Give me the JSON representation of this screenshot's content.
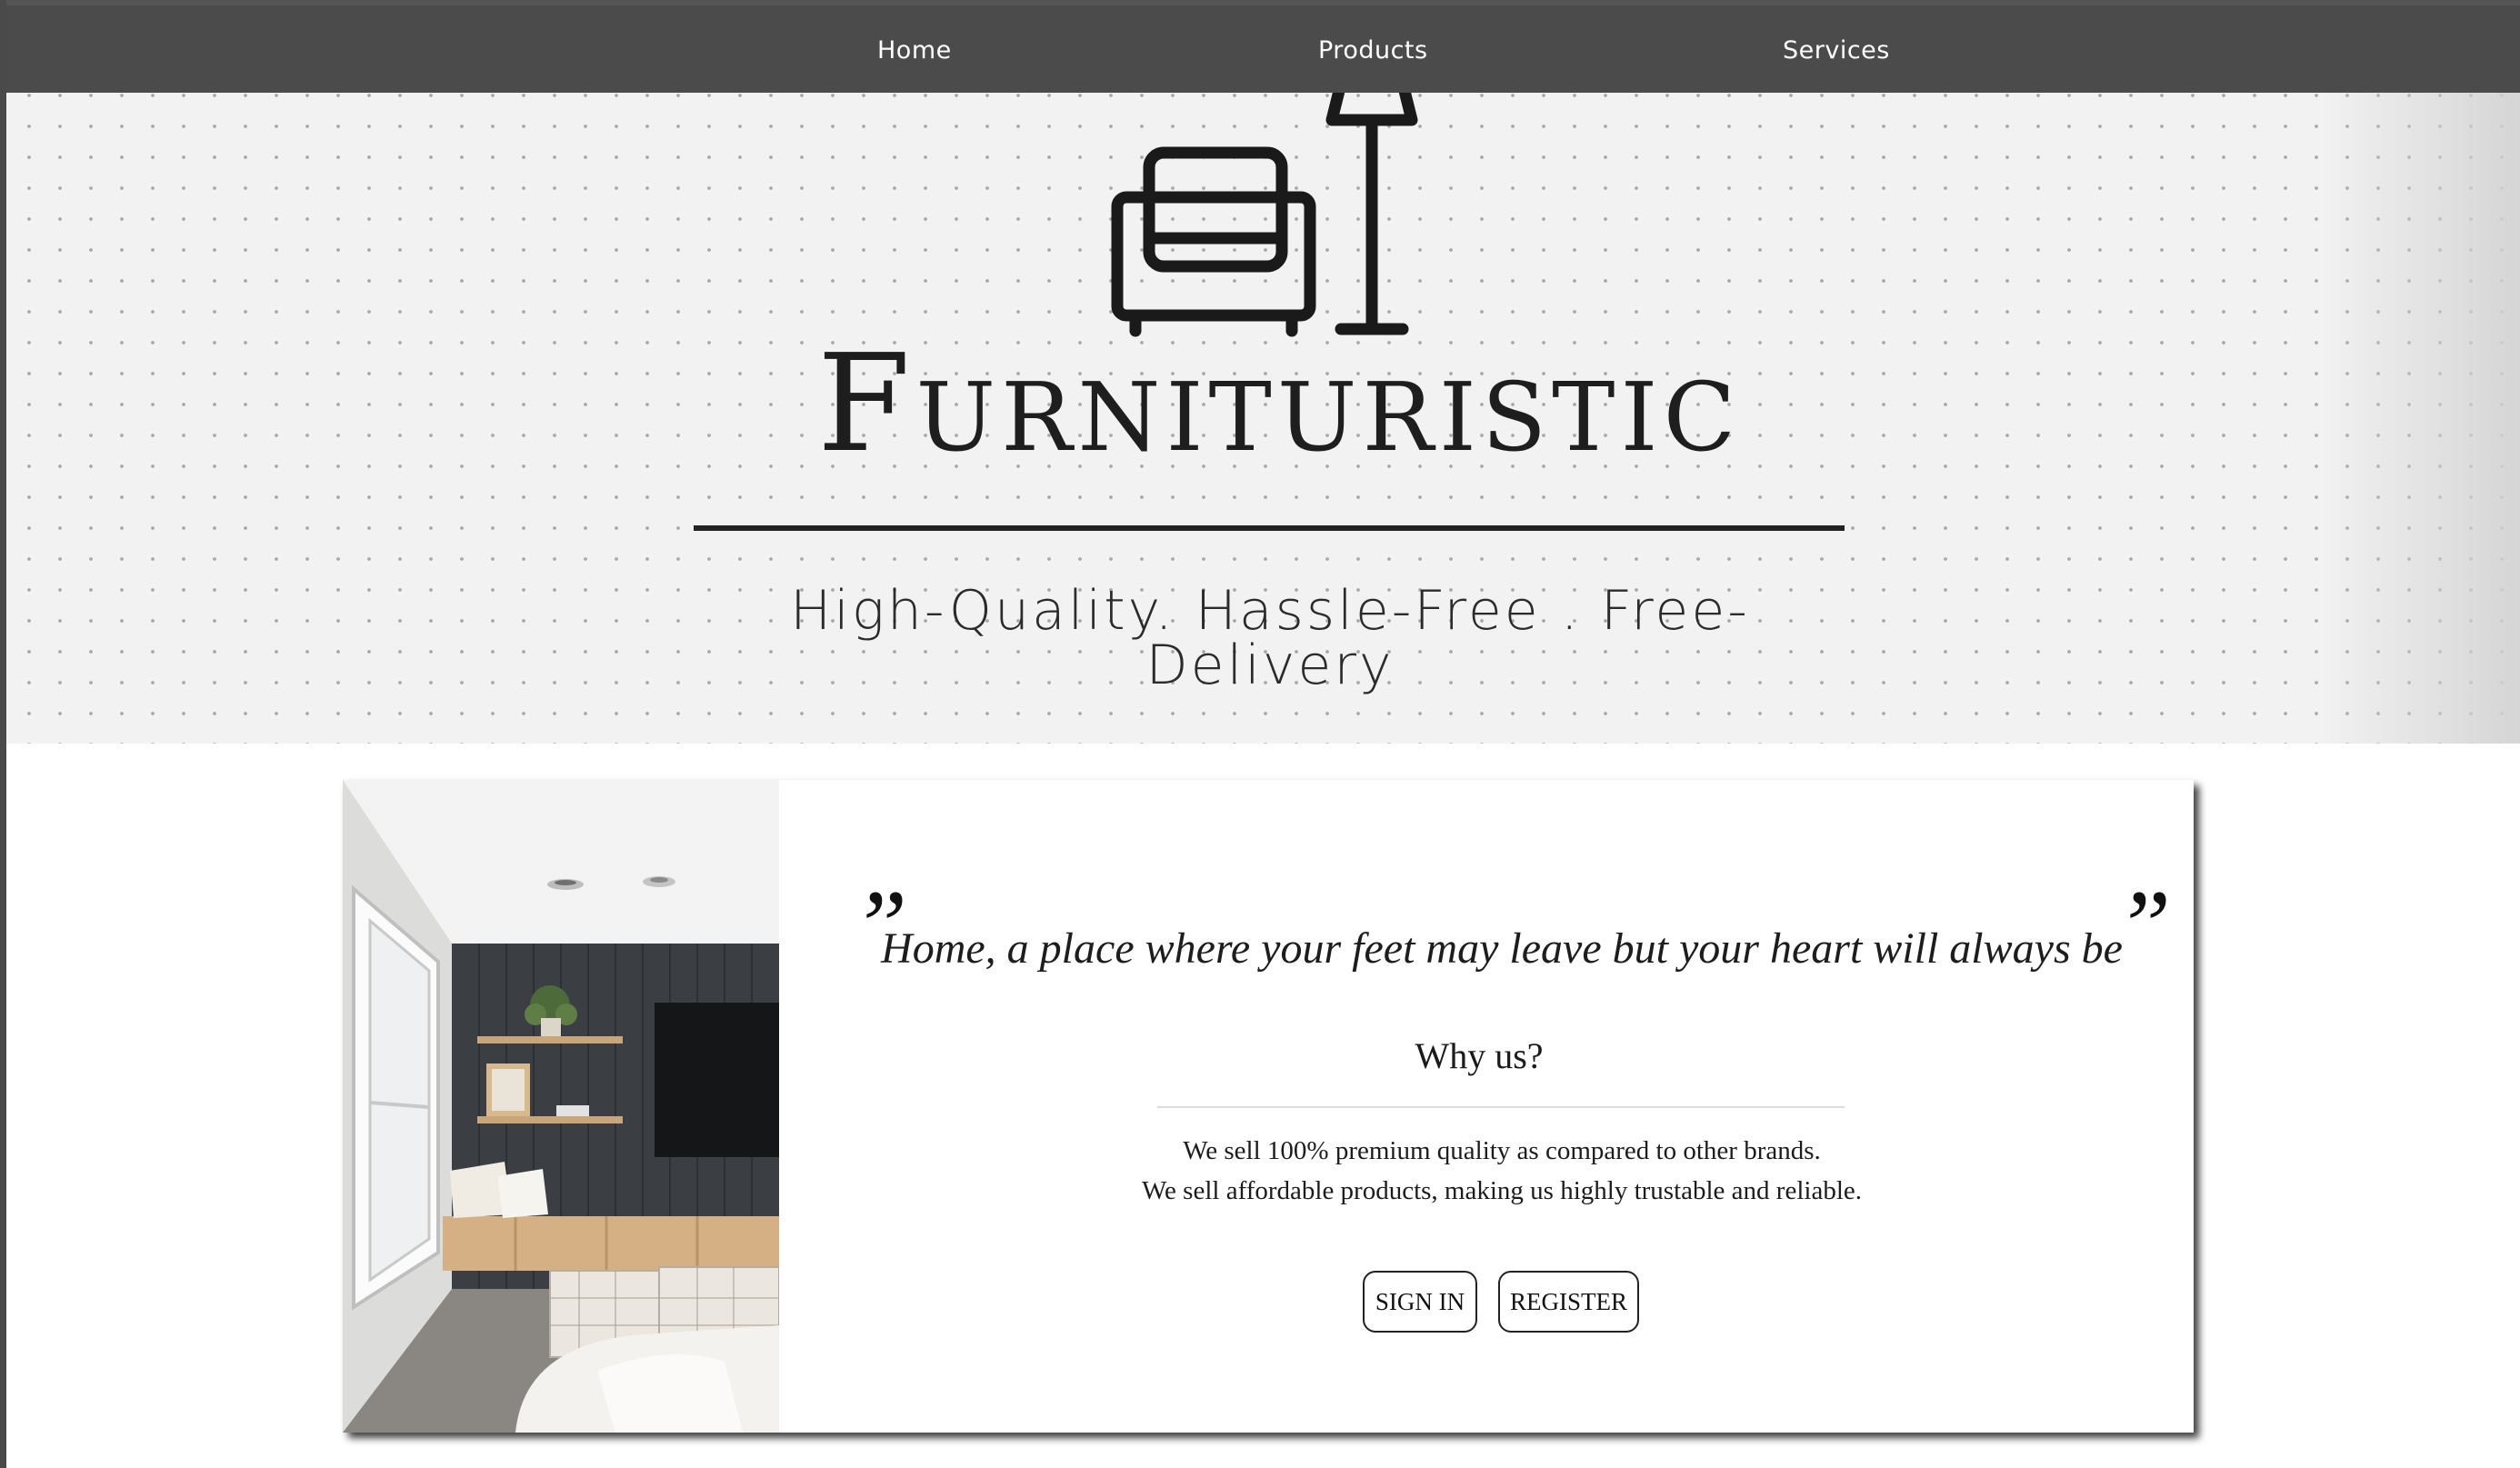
{
  "nav": {
    "items": [
      {
        "label": "Home"
      },
      {
        "label": "Products"
      },
      {
        "label": "Services"
      }
    ]
  },
  "hero": {
    "brand": "Furnituristic",
    "tagline": "High-Quality. Hassle-Free . Free-Delivery",
    "logo_icons": [
      "armchair-icon",
      "floor-lamp-icon"
    ]
  },
  "about": {
    "quote_open": "”",
    "quote": "Home, a place where your feet may leave but your heart will always be",
    "quote_close": "”",
    "why_title": "Why us?",
    "reasons": [
      "We sell 100% premium quality as compared to other brands.",
      "We sell affordable products, making us highly trustable and reliable."
    ],
    "buttons": {
      "sign_in": "SIGN IN",
      "register": "REGISTER"
    }
  },
  "colors": {
    "nav_bg": "#4b4b4b",
    "hero_bg": "#f2f2f2",
    "text_dark": "#1e1e1e"
  }
}
